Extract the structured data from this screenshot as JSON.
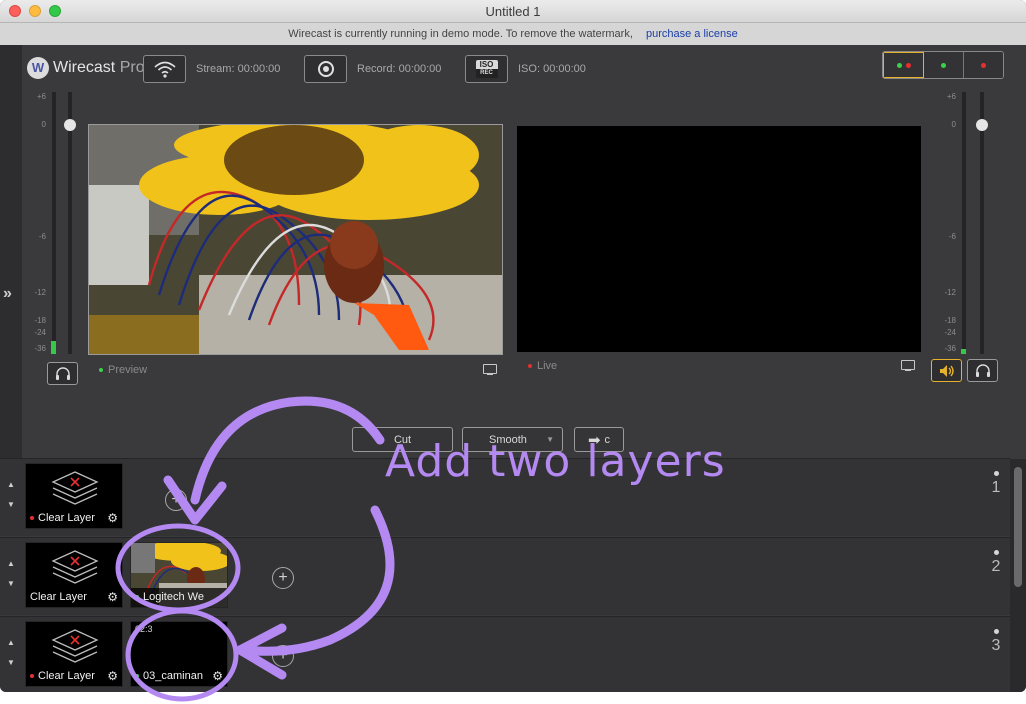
{
  "window": {
    "title": "Untitled 1"
  },
  "banner": {
    "message": "Wirecast is currently running in demo mode. To remove the watermark,",
    "link": "purchase a license"
  },
  "toolbar": {
    "logo_badge": "W",
    "logo_name": "Wirecast",
    "logo_edition": "Pro",
    "stream_label": "Stream:",
    "stream_time": "00:00:00",
    "record_label": "Record:",
    "record_time": "00:00:00",
    "iso_label": "ISO:",
    "iso_time": "00:00:00",
    "iso_icon_top": "ISO",
    "iso_icon_bottom": "REC"
  },
  "meters": {
    "left_scale": [
      "+6",
      "0",
      "-6",
      "-12",
      "-18",
      "-24",
      "-36"
    ],
    "right_scale": [
      "+6",
      "0",
      "-6",
      "-12",
      "-18",
      "-24",
      "-36"
    ],
    "left_level": 0.05,
    "right_level": 0.02
  },
  "monitors": {
    "preview_label": "Preview",
    "live_label": "Live",
    "preview_indicator": "#3bd04a",
    "live_indicator": "#e53030"
  },
  "transitions": {
    "cut_label": "Cut",
    "smooth_label": "Smooth",
    "go_label": "c"
  },
  "layers": [
    {
      "number": "1",
      "shots": [
        {
          "label": "Clear Layer",
          "indicator": "#e53030"
        }
      ]
    },
    {
      "number": "2",
      "shots": [
        {
          "label": "Clear Layer",
          "indicator": ""
        },
        {
          "label": "Logitech We",
          "indicator": "#3bd04a"
        }
      ]
    },
    {
      "number": "3",
      "shots": [
        {
          "label": "Clear Layer",
          "indicator": "#e53030"
        },
        {
          "label": "03_caminan",
          "indicator": "#3bd04a",
          "timecode": "02:3"
        }
      ]
    }
  ],
  "annotation": {
    "text": "Add two layers",
    "color": "#b48af2"
  },
  "icons": [
    "expand-icon",
    "broadcast-icon",
    "record-icon",
    "iso-icon",
    "headphones-icon",
    "speaker-icon",
    "display-icon",
    "gear-icon",
    "plus-icon",
    "arrow-right-icon",
    "stack-icon"
  ]
}
